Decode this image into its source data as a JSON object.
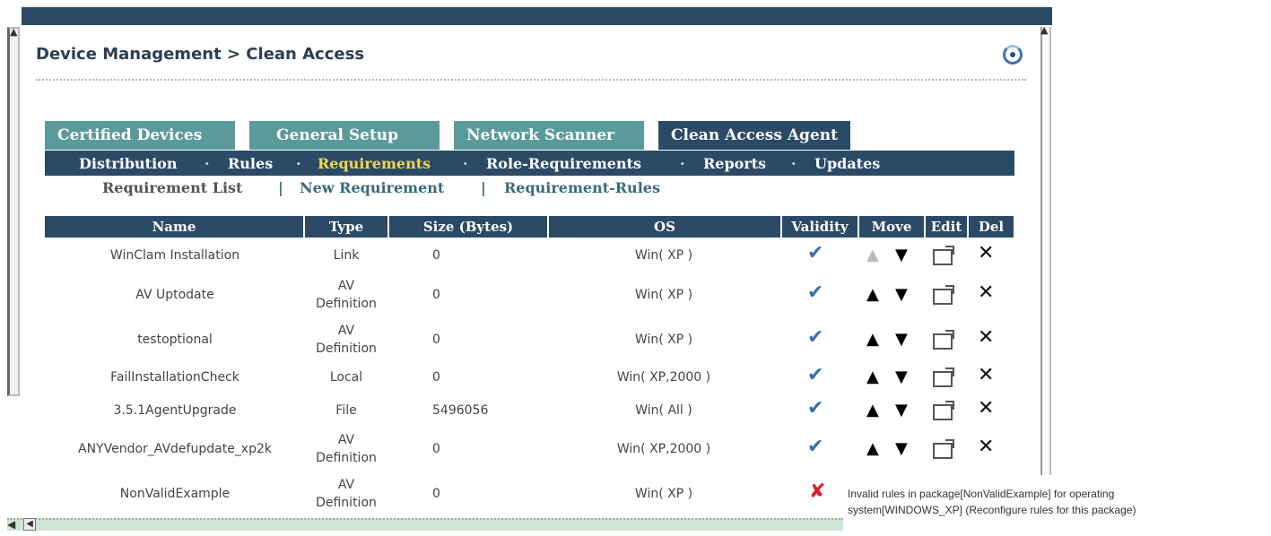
{
  "breadcrumb": "Device Management > Clean Access",
  "tabs": [
    {
      "label": "Certified Devices"
    },
    {
      "label": "General Setup"
    },
    {
      "label": "Network Scanner"
    },
    {
      "label": "Clean Access Agent"
    }
  ],
  "subnav": {
    "items": [
      "Distribution",
      "Rules",
      "Requirements",
      "Role-Requirements",
      "Reports",
      "Updates"
    ],
    "separator": "·"
  },
  "reqnav": {
    "list": "Requirement List",
    "new": "New Requirement",
    "rules": "Requirement-Rules",
    "separator": "|"
  },
  "table": {
    "headers": {
      "name": "Name",
      "type": "Type",
      "size": "Size (Bytes)",
      "os": "OS",
      "validity": "Validity",
      "move": "Move",
      "edit": "Edit",
      "del": "Del"
    },
    "rows": [
      {
        "name": "WinClam Installation",
        "type1": "Link",
        "type2": "",
        "size": "0",
        "os": "Win( XP )",
        "valid": true,
        "up_enabled": false
      },
      {
        "name": "AV Uptodate",
        "type1": "AV",
        "type2": "Definition",
        "size": "0",
        "os": "Win( XP )",
        "valid": true,
        "up_enabled": true
      },
      {
        "name": "testoptional",
        "type1": "AV",
        "type2": "Definition",
        "size": "0",
        "os": "Win( XP )",
        "valid": true,
        "up_enabled": true
      },
      {
        "name": "FailInstallationCheck",
        "type1": "Local",
        "type2": "",
        "size": "0",
        "os": "Win( XP,2000 )",
        "valid": true,
        "up_enabled": true
      },
      {
        "name": "3.5.1AgentUpgrade",
        "type1": "File",
        "type2": "",
        "size": "5496056",
        "os": "Win( All )",
        "valid": true,
        "up_enabled": true
      },
      {
        "name": "ANYVendor_AVdefupdate_xp2k",
        "type1": "AV",
        "type2": "Definition",
        "size": "0",
        "os": "Win( XP,2000 )",
        "valid": true,
        "up_enabled": true
      },
      {
        "name": "NonValidExample",
        "type1": "AV",
        "type2": "Definition",
        "size": "0",
        "os": "Win( XP )",
        "valid": false,
        "up_enabled": false
      }
    ]
  },
  "invalid_message": {
    "line1": "Invalid rules in package[NonValidExample] for operating",
    "line2": "system[WINDOWS_XP] (Reconfigure rules for this package)"
  },
  "glyphs": {
    "check": "✔",
    "cross": "✘",
    "up": "▲",
    "down": "▼",
    "del": "✕"
  },
  "colors": {
    "header_bg": "#2b4a66",
    "tab_bg": "#5b9a9a",
    "active_sub": "#f3d64a",
    "valid": "#3b6fb0",
    "invalid": "#d22222"
  }
}
